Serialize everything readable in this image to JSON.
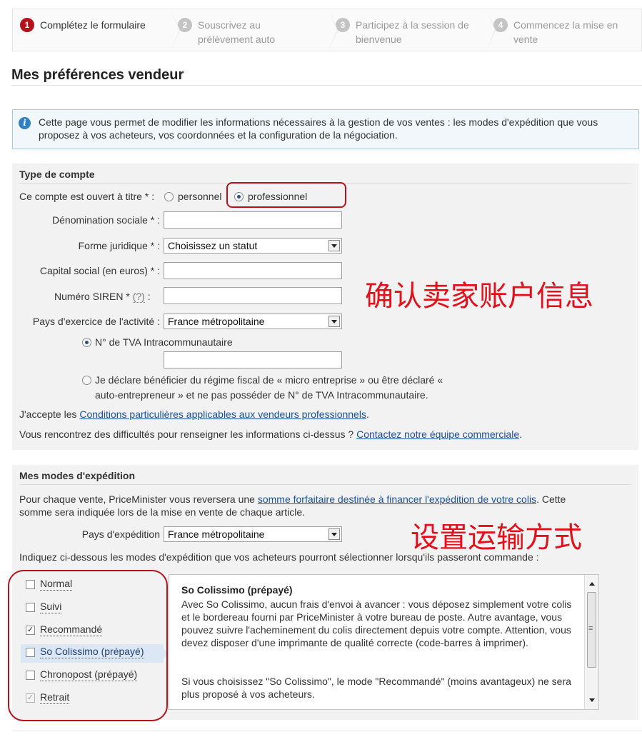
{
  "stepper": [
    {
      "num": "1",
      "label": "Complétez le formulaire",
      "active": true
    },
    {
      "num": "2",
      "label": "Souscrivez au prélèvement auto",
      "active": false
    },
    {
      "num": "3",
      "label": "Participez à la session de bienvenue",
      "active": false
    },
    {
      "num": "4",
      "label": "Commencez la mise en vente",
      "active": false
    }
  ],
  "page": {
    "title": "Mes préférences vendeur"
  },
  "info": {
    "text": "Cette page vous permet de modifier les informations nécessaires à la gestion de vos ventes : les modes d'expédition que vous proposez à vos acheteurs, vos coordonnées et la configuration de la négociation."
  },
  "account": {
    "heading": "Type de compte",
    "opened_label": "Ce compte est ouvert à titre * :",
    "opt_personal": "personnel",
    "opt_pro": "professionnel",
    "denomination_label": "Dénomination sociale * :",
    "denomination_value": "",
    "forme_label": "Forme juridique * :",
    "forme_value": "Choisissez un statut",
    "capital_label": "Capital social (en euros) * :",
    "capital_value": "",
    "siren_label": "Numéro SIREN *",
    "siren_help": "(?)",
    "siren_colon": ":",
    "siren_value": "",
    "pays_label": "Pays d'exercice de l'activité :",
    "pays_value": "France métropolitaine",
    "tva_label": "N° de TVA Intracommunautaire",
    "tva_value": "",
    "micro_line1": "Je déclare bénéficier du régime fiscal de « micro entreprise » ou être déclaré «",
    "micro_line2": "auto-entrepreneur » et ne pas posséder de N° de TVA Intracommunautaire.",
    "accept_prefix": "J'accepte les",
    "accept_link": "Conditions particulières applicables aux vendeurs professionnels",
    "accept_suffix": ".",
    "help_prefix": "Vous rencontrez des difficultés pour renseigner les informations ci-dessus ?",
    "help_link": "Contactez notre équipe commerciale",
    "help_suffix": "."
  },
  "annotations": {
    "account": "确认卖家账户信息",
    "shipping": "设置运输方式"
  },
  "shipping": {
    "heading": "Mes modes d'expédition",
    "intro_prefix": "Pour chaque vente, PriceMinister vous reversera une",
    "intro_link": "somme forfaitaire destinée à financer l'expédition de votre colis",
    "intro_suffix": ". Cette",
    "intro_line2": "somme sera indiquée lors de la mise en vente de chaque article.",
    "pays_label": "Pays d'expédition",
    "pays_value": "France métropolitaine",
    "indiquez": "Indiquez ci-dessous les modes d'expédition que vos acheteurs pourront sélectionner lorsqu'ils passeront commande :",
    "modes": [
      {
        "label": "Normal",
        "checked": false,
        "disabled": false,
        "selected": false
      },
      {
        "label": "Suivi",
        "checked": false,
        "disabled": false,
        "selected": false
      },
      {
        "label": "Recommandé",
        "checked": true,
        "disabled": false,
        "selected": false
      },
      {
        "label": "So Colissimo (prépayé)",
        "checked": false,
        "disabled": false,
        "selected": true
      },
      {
        "label": "Chronopost (prépayé)",
        "checked": false,
        "disabled": false,
        "selected": false
      },
      {
        "label": "Retrait",
        "checked": true,
        "disabled": true,
        "selected": false
      }
    ],
    "detail_title": "So Colissimo (prépayé)",
    "detail_p1": "Avec So Colissimo, aucun frais d'envoi à avancer : vous déposez simplement votre colis et le bordereau fourni par PriceMinister à votre bureau de poste. Autre avantage, vous pouvez suivre l'acheminement du colis directement depuis votre compte. Attention, vous devez disposer d'une imprimante de qualité correcte (code-barres à imprimer).",
    "detail_p2": "Si vous choisissez \"So Colissimo\", le mode \"Recommandé\" (moins avantageux) ne sera plus proposé à vos acheteurs."
  }
}
